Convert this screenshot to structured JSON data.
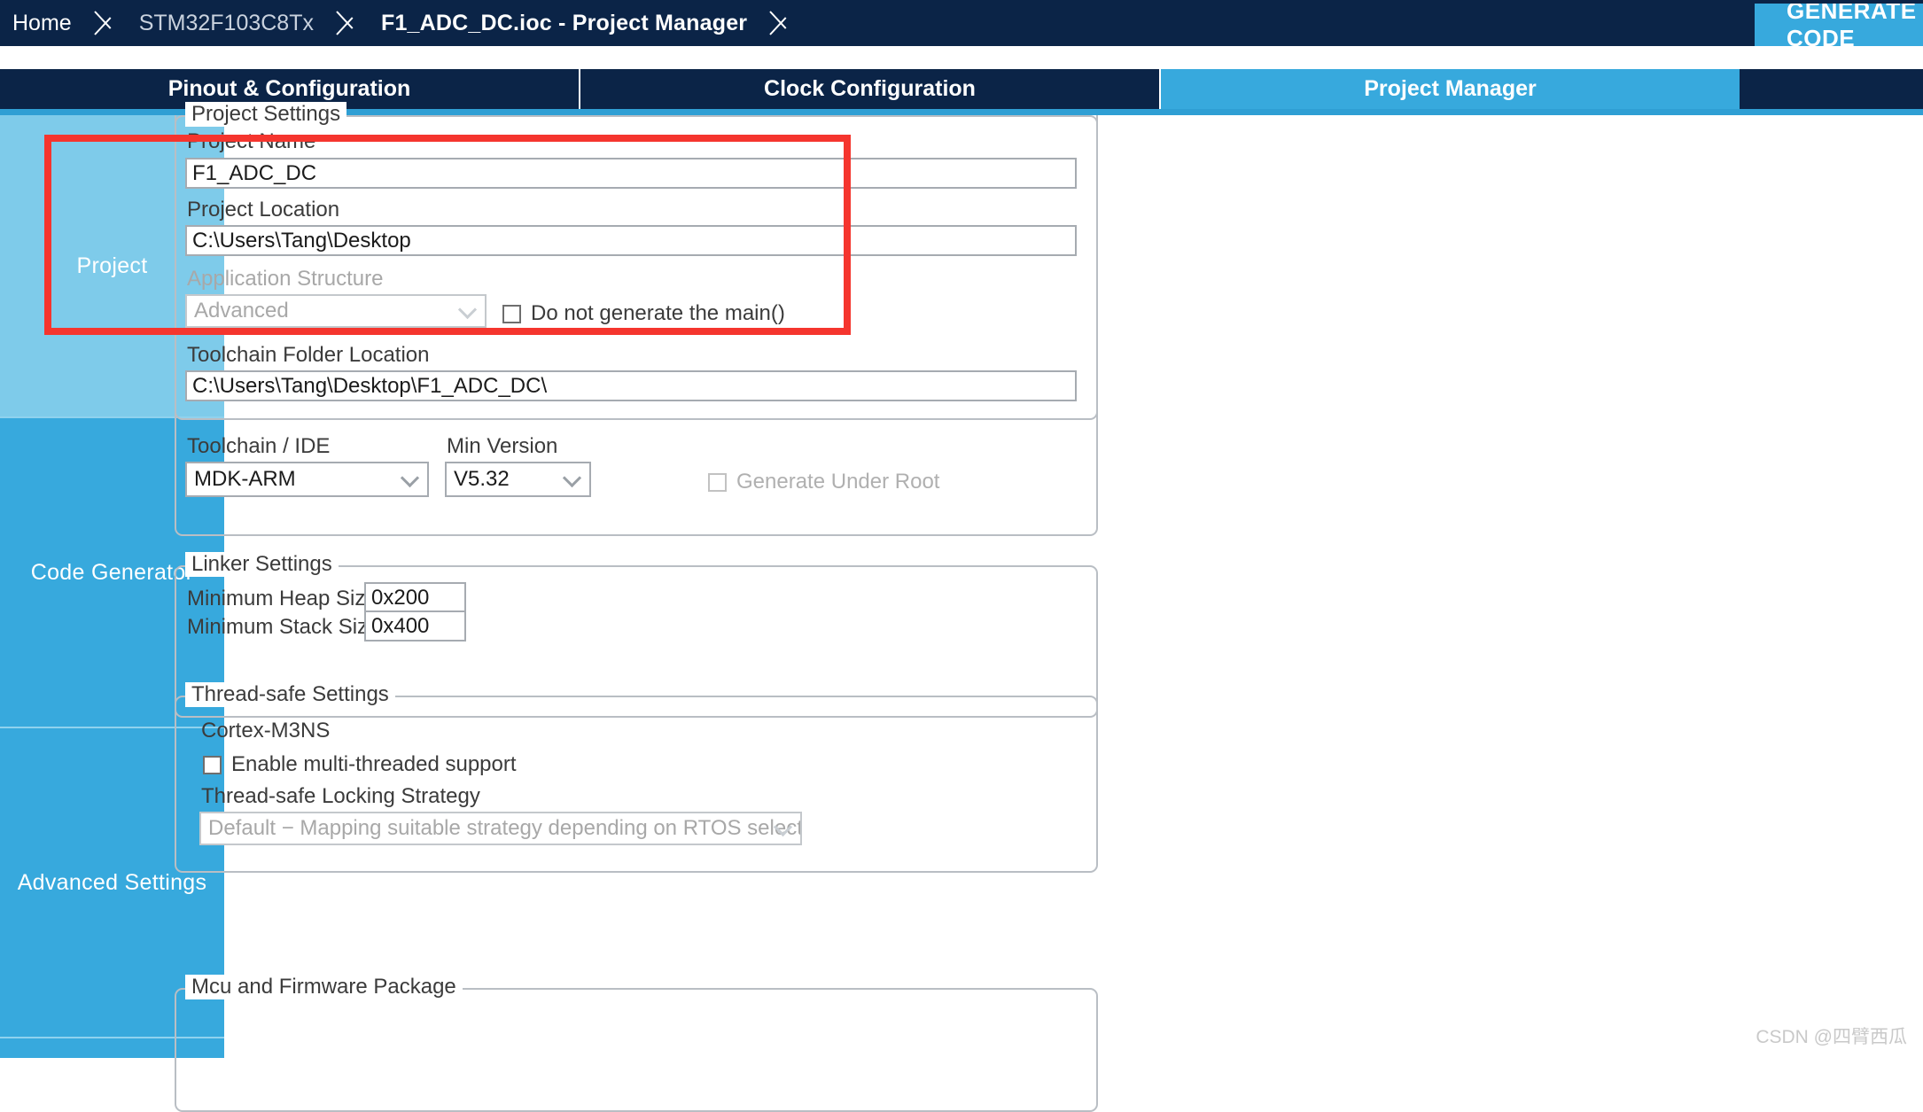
{
  "breadcrumb": {
    "items": [
      {
        "label": "Home",
        "state": "normal"
      },
      {
        "label": "STM32F103C8Tx",
        "state": "dim"
      },
      {
        "label": "F1_ADC_DC.ioc - Project Manager",
        "state": "active"
      }
    ]
  },
  "header": {
    "generate_button": "GENERATE CODE"
  },
  "tabs": [
    {
      "label": "Pinout & Configuration",
      "selected": false
    },
    {
      "label": "Clock Configuration",
      "selected": false
    },
    {
      "label": "Project Manager",
      "selected": true
    }
  ],
  "sidebar": {
    "items": [
      {
        "label": "Project",
        "selected": true
      },
      {
        "label": "Code Generator",
        "selected": false
      },
      {
        "label": "Advanced Settings",
        "selected": false
      }
    ]
  },
  "project_settings": {
    "legend": "Project Settings",
    "project_name_label": "Project Name",
    "project_name_value": "F1_ADC_DC",
    "project_location_label": "Project Location",
    "project_location_value": "C:\\Users\\Tang\\Desktop",
    "application_structure_label": "Application Structure",
    "application_structure_value": "Advanced",
    "do_not_generate_main_label": "Do not generate the main()",
    "do_not_generate_main_checked": false,
    "toolchain_folder_label": "Toolchain Folder Location",
    "toolchain_folder_value": "C:\\Users\\Tang\\Desktop\\F1_ADC_DC\\",
    "toolchain_ide_label": "Toolchain / IDE",
    "toolchain_ide_value": "MDK-ARM",
    "min_version_label": "Min Version",
    "min_version_value": "V5.32",
    "generate_under_root_label": "Generate Under Root",
    "generate_under_root_checked": false
  },
  "linker_settings": {
    "legend": "Linker Settings",
    "min_heap_label": "Minimum Heap Size",
    "min_heap_value": "0x200",
    "min_stack_label": "Minimum Stack Size",
    "min_stack_value": "0x400"
  },
  "thread_safe_settings": {
    "legend": "Thread-safe Settings",
    "cortex_label": "Cortex-M3NS",
    "enable_multithread_label": "Enable multi-threaded support",
    "enable_multithread_checked": false,
    "locking_strategy_label": "Thread-safe Locking Strategy",
    "locking_strategy_value": "Default  −  Mapping suitable strategy depending on RTOS selection."
  },
  "mcu_firmware_package": {
    "legend": "Mcu and Firmware Package"
  },
  "watermark": {
    "text": "CSDN @四臂西瓜"
  },
  "colors": {
    "header_navy": "#0b2447",
    "accent_blue": "#37a9dd",
    "selected_light_blue": "#7ecbea",
    "annotation_red": "#f5352e"
  }
}
